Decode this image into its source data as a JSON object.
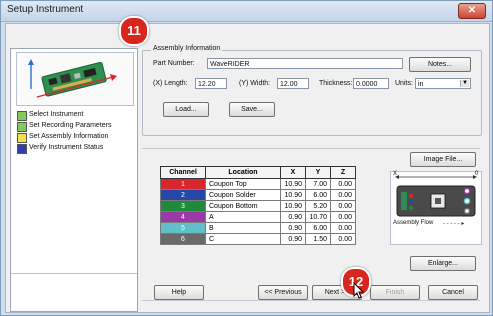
{
  "window": {
    "title": "Setup Instrument",
    "close_glyph": "✕"
  },
  "steps": [
    {
      "label": "Select Instrument",
      "color": "#86c85a"
    },
    {
      "label": "Set Recording Parameters",
      "color": "#86c85a"
    },
    {
      "label": "Set Assembly Information",
      "color": "#f2e14a"
    },
    {
      "label": "Verify Instrument Status",
      "color": "#2b3fb0"
    }
  ],
  "callouts": {
    "first": "11",
    "second": "12"
  },
  "assembly": {
    "group_label": "Assembly Information",
    "part_number_label": "Part Number:",
    "part_number": "WaveRIDER",
    "notes_button": "Notes...",
    "length_label": "(X) Length:",
    "length": "12.20",
    "width_label": "(Y) Width:",
    "width": "12.00",
    "thickness_label": "Thickness:",
    "thickness": "0.0000",
    "units_label": "Units:",
    "units": "in",
    "load_button": "Load...",
    "save_button": "Save..."
  },
  "image_file_button": "Image File...",
  "enlarge_button": "Enlarge...",
  "table": {
    "headers": [
      "Channel",
      "Location",
      "X",
      "Y",
      "Z"
    ],
    "rows": [
      {
        "channel": "1",
        "color": "#d9262c",
        "location": "Coupon Top",
        "x": "10.90",
        "y": "7.00",
        "z": "0.00"
      },
      {
        "channel": "2",
        "color": "#2448a8",
        "location": "Coupon Solder",
        "x": "10.90",
        "y": "6.00",
        "z": "0.00"
      },
      {
        "channel": "3",
        "color": "#1f8a3a",
        "location": "Coupon Bottom",
        "x": "10.90",
        "y": "5.20",
        "z": "0.00"
      },
      {
        "channel": "4",
        "color": "#9a3aa8",
        "location": "A",
        "x": "0.90",
        "y": "10.70",
        "z": "0.00"
      },
      {
        "channel": "5",
        "color": "#5fc0c8",
        "location": "B",
        "x": "0.90",
        "y": "6.00",
        "z": "0.00"
      },
      {
        "channel": "6",
        "color": "#6a6a6a",
        "location": "C",
        "x": "0.90",
        "y": "1.50",
        "z": "0.00"
      }
    ]
  },
  "diagram": {
    "x_label": "X",
    "y_label": "0",
    "flow_label": "Assembly Flow",
    "flow_arrow": "- - - - - ▸"
  },
  "footer": {
    "help": "Help",
    "previous": "<< Previous",
    "next": "Next >>",
    "finish": "Finish",
    "cancel": "Cancel"
  }
}
